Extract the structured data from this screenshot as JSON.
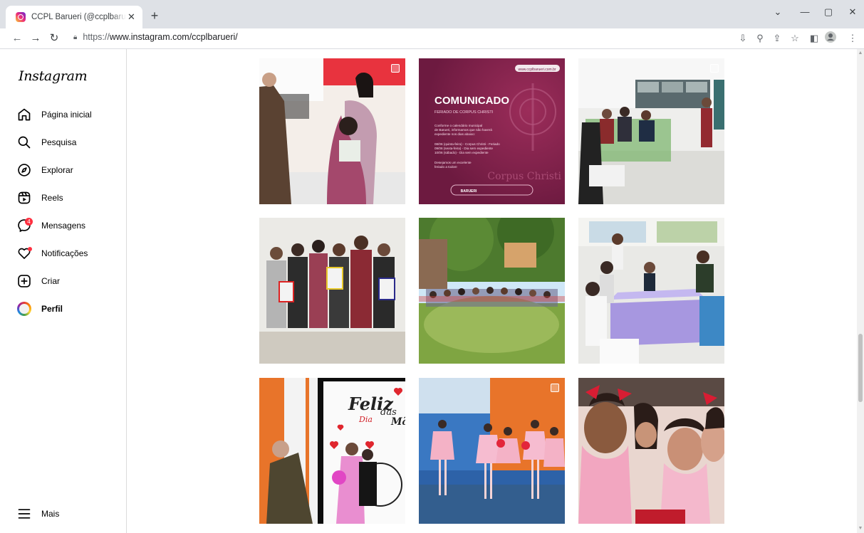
{
  "browser": {
    "tab_title": "CCPL Barueri (@ccplbarueri) • Fotos e vídeos do Instagram",
    "tab_close": "✕",
    "new_tab": "+",
    "url_scheme": "https://",
    "url_host": "www.instagram.com/ccplbarueri/",
    "window_controls": [
      "⌄",
      "—",
      "▢",
      "✕"
    ]
  },
  "sidebar": {
    "logo": "Instagram",
    "items": [
      {
        "label": "Página inicial",
        "icon": "home-icon"
      },
      {
        "label": "Pesquisa",
        "icon": "search-icon"
      },
      {
        "label": "Explorar",
        "icon": "compass-icon"
      },
      {
        "label": "Reels",
        "icon": "reels-icon"
      },
      {
        "label": "Mensagens",
        "icon": "messenger-icon",
        "badge": "4"
      },
      {
        "label": "Notificações",
        "icon": "heart-icon"
      },
      {
        "label": "Criar",
        "icon": "plus-square-icon"
      },
      {
        "label": "Perfil",
        "icon": "avatar"
      }
    ],
    "more": {
      "label": "Mais",
      "icon": "hamburger-icon"
    }
  },
  "posts": [
    {
      "alt": "Aula de cabeleireiro",
      "multi": true
    },
    {
      "alt": "Comunicado feriado de Corpus Christi",
      "multi": false,
      "text": {
        "site": "www.ccplbarueri.com.br",
        "title": "COMUNICADO",
        "subtitle": "FERIADO DE CORPUS CHRISTI",
        "body": [
          "Conforme o calendário municipal",
          "de Barueri, informamos que não haverá",
          "expediente nos dias abaixo:",
          "",
          "08/06 (quinta-feira) - Corpus Christi - Feriado",
          "09/06 (sexta-feira) - Dia sem expediente",
          "10/06 (sábado) - Dia sem expediente",
          "",
          "Desejamos um excelente",
          "feriado a todos!"
        ],
        "watermark": "Corpus Christi",
        "footer": "BARUERI"
      }
    },
    {
      "alt": "Sala de aula com alunos",
      "multi": true
    },
    {
      "alt": "Jovens com cartazes",
      "multi": false
    },
    {
      "alt": "Roda de crianças no pátio",
      "multi": false
    },
    {
      "alt": "Grupo ao redor de mesa lilás",
      "multi": false
    },
    {
      "alt": "Dia das Mães",
      "multi": false,
      "text": {
        "line1": "Feliz",
        "line2": "Dia",
        "line3": "das",
        "line4": "Mã"
      }
    },
    {
      "alt": "Apresentação de balé",
      "multi": true
    },
    {
      "alt": "Meninas bailarinas sorrindo",
      "multi": false
    }
  ],
  "colors": {
    "badge": "#ff3040",
    "comunicado_bg": "#7b1d47",
    "tab_strip": "#dee1e6"
  }
}
